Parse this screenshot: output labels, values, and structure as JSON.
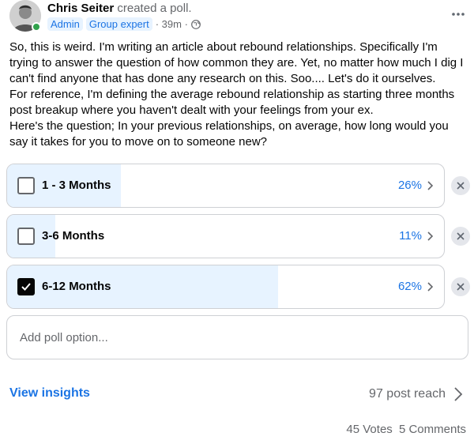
{
  "post": {
    "author": "Chris Seiter",
    "action": "created a poll.",
    "badges": [
      "Admin",
      "Group expert"
    ],
    "time": "· 39m ·",
    "body": [
      "So, this is weird. I'm writing an article about rebound relationships. Specifically I'm trying to answer the question of how common they are. Yet, no matter how much I dig I can't find anyone that has done any research on this. Soo.... Let's do it ourselves.",
      "For reference, I'm defining the average rebound relationship as starting three months post breakup where you haven't dealt with your feelings from your ex.",
      "Here's the question; In your previous relationships, on average, how long would you say it takes for you to move on to someone new?"
    ]
  },
  "poll": {
    "options": [
      {
        "label": "1 - 3 Months",
        "percent_text": "26%",
        "percent": 26,
        "checked": false
      },
      {
        "label": "3-6 Months",
        "percent_text": "11%",
        "percent": 11,
        "checked": false
      },
      {
        "label": "6-12 Months",
        "percent_text": "62%",
        "percent": 62,
        "checked": true
      }
    ],
    "add_placeholder": "Add poll option..."
  },
  "footer": {
    "insights_label": "View insights",
    "reach_label": "97 post reach",
    "votes": "45 Votes",
    "comments": "5 Comments"
  },
  "colors": {
    "accent": "#1b74e4",
    "fill": "#e7f3ff",
    "online": "#31a24c"
  },
  "icons": {
    "more": "more-icon",
    "globe": "globe-icon",
    "chevron": "chevron-right-icon",
    "close": "close-icon",
    "check": "check-icon"
  }
}
